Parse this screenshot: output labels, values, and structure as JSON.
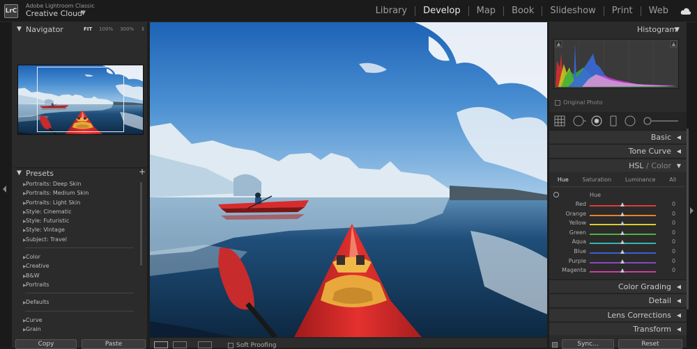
{
  "app": {
    "subtitle": "Adobe Lightroom Classic",
    "title": "Creative Cloud",
    "logo_text": "LrC"
  },
  "modules": [
    "Library",
    "Develop",
    "Map",
    "Book",
    "Slideshow",
    "Print",
    "Web"
  ],
  "active_module": "Develop",
  "navigator": {
    "title": "Navigator",
    "zoom": [
      "FIT",
      "100%",
      "300%"
    ]
  },
  "presets": {
    "title": "Presets",
    "groups": [
      [
        "Portraits: Deep Skin",
        "Portraits: Medium Skin",
        "Portraits: Light Skin",
        "Style: Cinematic",
        "Style: Futuristic",
        "Style: Vintage",
        "Subject: Travel"
      ],
      [
        "Color",
        "Creative",
        "B&W",
        "Portraits"
      ],
      [
        "Defaults"
      ],
      [
        "Curve",
        "Grain"
      ]
    ]
  },
  "left_buttons": {
    "copy": "Copy",
    "paste": "Paste"
  },
  "toolbar": {
    "soft_proofing": "Soft Proofing"
  },
  "histogram": {
    "title": "Histogram",
    "original_photo": "Original Photo"
  },
  "sections": {
    "basic": "Basic",
    "tone_curve": "Tone Curve",
    "hsl": "HSL",
    "hsl_sep": "/",
    "color": "Color",
    "color_grading": "Color Grading",
    "detail": "Detail",
    "lens_corrections": "Lens Corrections",
    "transform": "Transform"
  },
  "hsl_tabs": [
    "Hue",
    "Saturation",
    "Luminance",
    "All"
  ],
  "hue_label": "Hue",
  "hue_sliders": [
    {
      "name": "Red",
      "value": "0",
      "color": "#e23b3b"
    },
    {
      "name": "Orange",
      "value": "0",
      "color": "#e8822a"
    },
    {
      "name": "Yellow",
      "value": "0",
      "color": "#d9cf2b"
    },
    {
      "name": "Green",
      "value": "0",
      "color": "#4fb33d"
    },
    {
      "name": "Aqua",
      "value": "0",
      "color": "#33b8b0"
    },
    {
      "name": "Blue",
      "value": "0",
      "color": "#3a5fd6"
    },
    {
      "name": "Purple",
      "value": "0",
      "color": "#8a46c9"
    },
    {
      "name": "Magenta",
      "value": "0",
      "color": "#cf3aa8"
    }
  ],
  "right_buttons": {
    "sync": "Sync...",
    "reset": "Reset"
  }
}
